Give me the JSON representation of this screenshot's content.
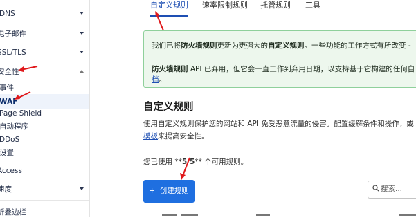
{
  "sidebar": {
    "items": [
      {
        "label": "DNS",
        "chevron": "down"
      },
      {
        "label": "电子邮件",
        "chevron": "down"
      },
      {
        "label": "SSL/TLS",
        "chevron": "down"
      },
      {
        "label": "安全性",
        "chevron": "up"
      },
      {
        "label": "事件"
      },
      {
        "label": "WAF"
      },
      {
        "label": "Page Shield"
      },
      {
        "label": "自动程序"
      },
      {
        "label": "DDoS"
      },
      {
        "label": "设置"
      },
      {
        "label": "Access"
      },
      {
        "label": "速度",
        "chevron": "down"
      },
      {
        "label": "折叠边栏"
      }
    ]
  },
  "tabs": [
    {
      "label": "自定义规则"
    },
    {
      "label": "速率限制规则"
    },
    {
      "label": "托管规则"
    },
    {
      "label": "工具"
    }
  ],
  "notice": {
    "l1_pre": "我们已将",
    "l1_bold1": "防火墙规则",
    "l1_mid": "更新为更强大的",
    "l1_bold2": "自定义规则",
    "l1_post": "。一些功能的工作方式有所改变 -",
    "l2_bold": "防火墙规则",
    "l2_text": " API 已弃用，但它会一直工作到弃用日期，以支持基于它构建的任何自",
    "l3_link": "档",
    "l3_post": "。"
  },
  "main": {
    "title": "自定义规则",
    "desc_line1": "使用自定义规则保护您的网站和 API 免受恶意流量的侵害。配置缓解条件和操作，或",
    "desc_link": "模板",
    "desc_line2_post": "来提高安全性。",
    "usage_pre": "您已使用 **",
    "usage_count": "5/5",
    "usage_post": "** 个可用规则。",
    "create_button": "创建规则",
    "create_plus": "+",
    "search_placeholder": "搜索..."
  },
  "colors": {
    "primary": "#1f6fe0",
    "link": "#1e4fb3",
    "notice_bg": "#edf7ed",
    "notice_border": "#8fd09b",
    "annotation_arrow": "#e0181b"
  }
}
